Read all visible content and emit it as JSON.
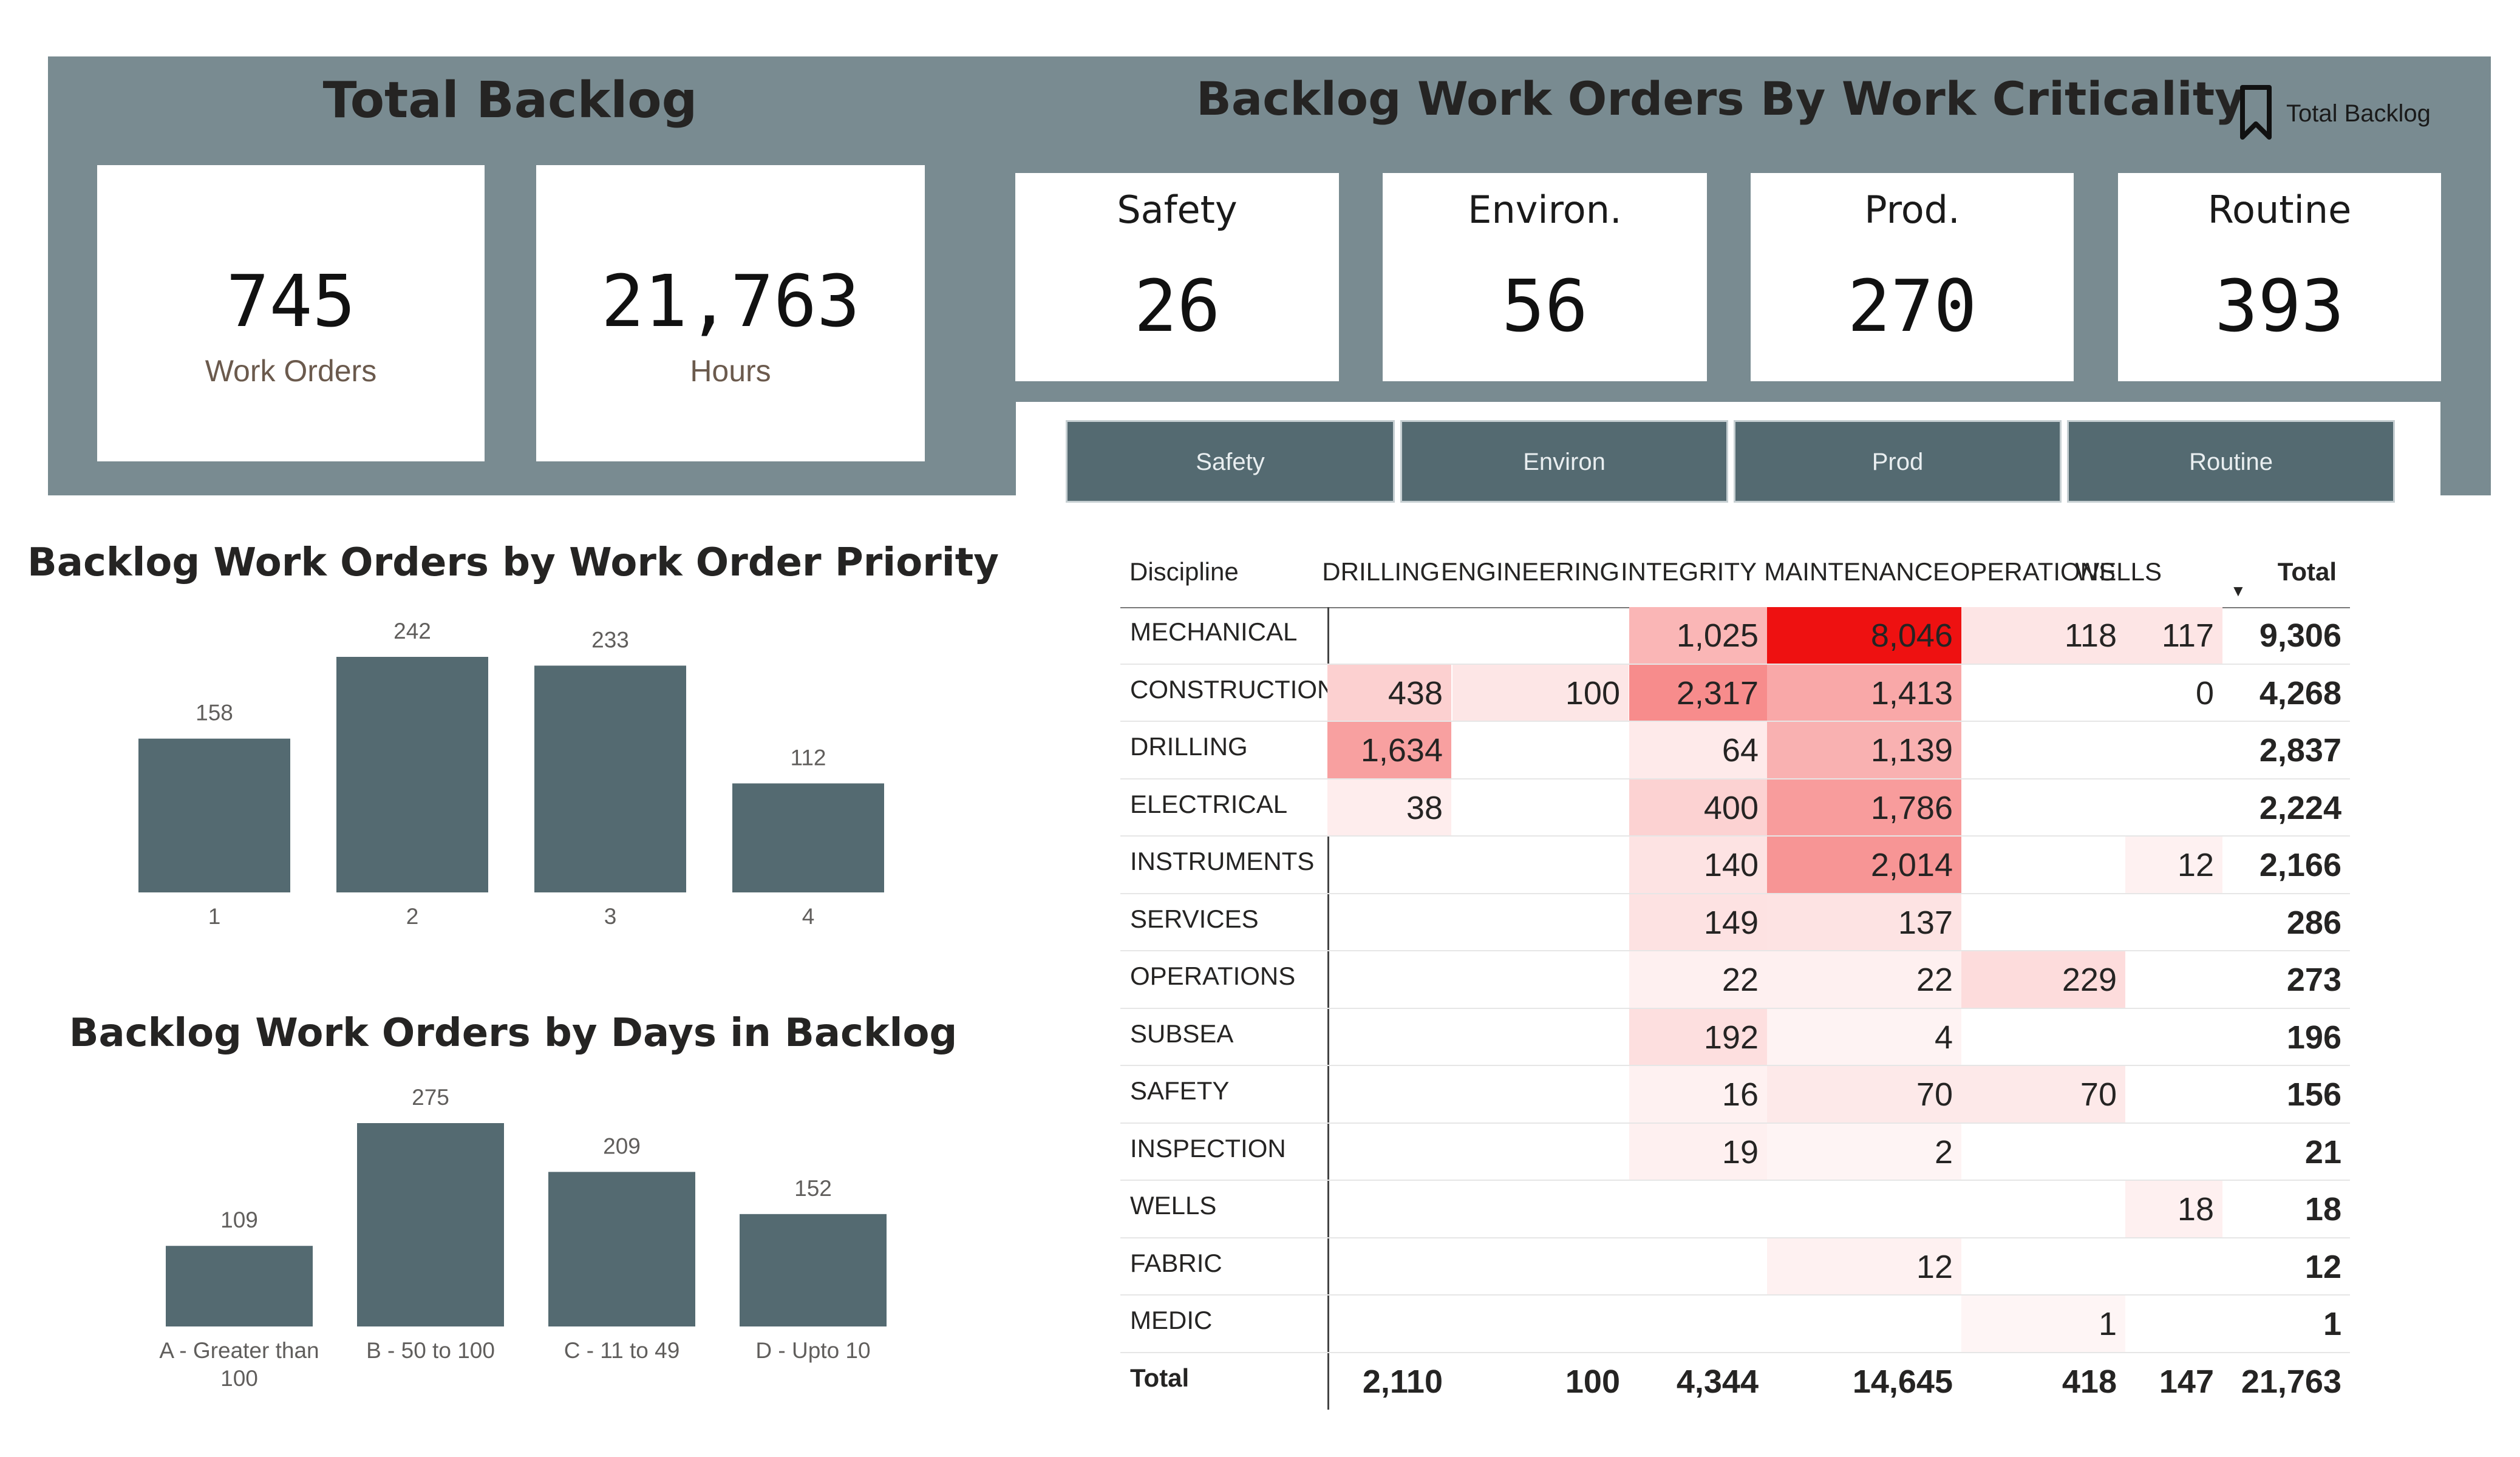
{
  "total_backlog": {
    "title": "Total Backlog",
    "work_orders": {
      "value": "745",
      "label": "Work Orders"
    },
    "hours": {
      "value": "21,763",
      "label": "Hours"
    }
  },
  "criticality": {
    "title": "Backlog Work Orders By Work Criticality",
    "bookmark_label": "Total Backlog",
    "cards": [
      {
        "label": "Safety",
        "value": "26"
      },
      {
        "label": "Environ.",
        "value": "56"
      },
      {
        "label": "Prod.",
        "value": "270"
      },
      {
        "label": "Routine",
        "value": "393"
      }
    ],
    "filter_buttons": [
      "Safety",
      "Environ",
      "Prod",
      "Routine"
    ]
  },
  "chart_data": [
    {
      "type": "bar",
      "title": "Backlog Work Orders by Work Order Priority",
      "categories": [
        "1",
        "2",
        "3",
        "4"
      ],
      "values": [
        158,
        242,
        233,
        112
      ],
      "color": "#546a71",
      "data_labels": true
    },
    {
      "type": "bar",
      "title": "Backlog Work Orders by Days in Backlog",
      "categories": [
        "A - Greater than 100",
        "B - 50 to 100",
        "C - 11 to 49",
        "D - Upto 10"
      ],
      "category_lines": [
        [
          "A - Greater than",
          "100"
        ],
        [
          "B - 50 to 100"
        ],
        [
          "C - 11 to 49"
        ],
        [
          "D - Upto 10"
        ]
      ],
      "values": [
        109,
        275,
        209,
        152
      ],
      "color": "#546a71",
      "data_labels": true
    }
  ],
  "matrix": {
    "corner_label": "Discipline",
    "columns": [
      "DRILLING",
      "ENGINEERING",
      "INTEGRITY",
      "MAINTENANCE",
      "OPERATIONS",
      "WELLS",
      "Total"
    ],
    "sort_indicator": "▼",
    "rows": [
      {
        "label": "MECHANICAL",
        "cells": [
          null,
          null,
          1025,
          8046,
          118,
          117
        ],
        "total": 9306
      },
      {
        "label": "CONSTRUCTION",
        "cells": [
          438,
          100,
          2317,
          1413,
          null,
          0
        ],
        "total": 4268
      },
      {
        "label": "DRILLING",
        "cells": [
          1634,
          null,
          64,
          1139,
          null,
          null
        ],
        "total": 2837
      },
      {
        "label": "ELECTRICAL",
        "cells": [
          38,
          null,
          400,
          1786,
          null,
          null
        ],
        "total": 2224
      },
      {
        "label": "INSTRUMENTS",
        "cells": [
          null,
          null,
          140,
          2014,
          null,
          12
        ],
        "total": 2166
      },
      {
        "label": "SERVICES",
        "cells": [
          null,
          null,
          149,
          137,
          null,
          null
        ],
        "total": 286
      },
      {
        "label": "OPERATIONS",
        "cells": [
          null,
          null,
          22,
          22,
          229,
          null
        ],
        "total": 273
      },
      {
        "label": "SUBSEA",
        "cells": [
          null,
          null,
          192,
          4,
          null,
          null
        ],
        "total": 196
      },
      {
        "label": "SAFETY",
        "cells": [
          null,
          null,
          16,
          70,
          70,
          null
        ],
        "total": 156
      },
      {
        "label": "INSPECTION",
        "cells": [
          null,
          null,
          19,
          2,
          null,
          null
        ],
        "total": 21
      },
      {
        "label": "WELLS",
        "cells": [
          null,
          null,
          null,
          null,
          null,
          18
        ],
        "total": 18
      },
      {
        "label": "FABRIC",
        "cells": [
          null,
          null,
          null,
          12,
          null,
          null
        ],
        "total": 12
      },
      {
        "label": "MEDIC",
        "cells": [
          null,
          null,
          null,
          null,
          1,
          null
        ],
        "total": 1
      }
    ],
    "total_row": {
      "label": "Total",
      "cells": [
        2110,
        100,
        4344,
        14645,
        418,
        147
      ],
      "total": 21763
    },
    "heat_color": "#ee1111"
  }
}
